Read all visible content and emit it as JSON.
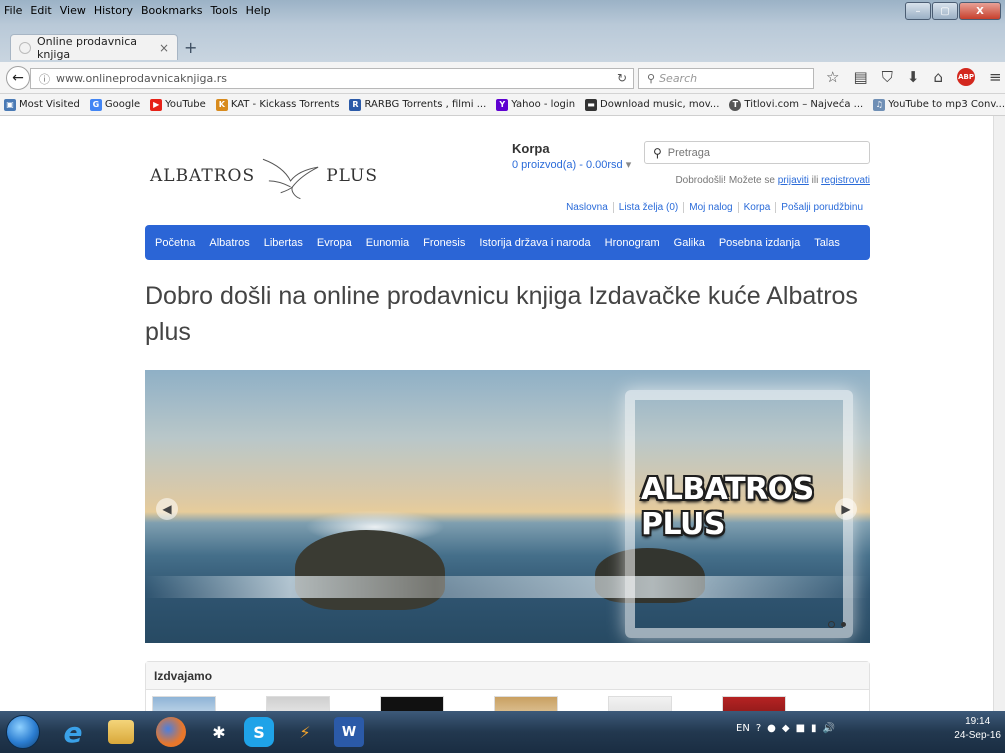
{
  "browser": {
    "menu": [
      "File",
      "Edit",
      "View",
      "History",
      "Bookmarks",
      "Tools",
      "Help"
    ],
    "tab_title": "Online prodavnica knjiga",
    "tab_close": "×",
    "new_tab": "+",
    "url": "www.onlineprodavnicaknjiga.rs",
    "search_placeholder": "Search",
    "window_buttons": [
      "–",
      "▢",
      "X"
    ],
    "bookmarks": [
      {
        "label": "Most Visited",
        "icon": "most-visited-icon",
        "color": "#4a7ab5"
      },
      {
        "label": "Google",
        "icon": "google-icon",
        "color": "#4285f4"
      },
      {
        "label": "YouTube",
        "icon": "youtube-icon",
        "color": "#e62117"
      },
      {
        "label": "KAT - Kickass Torrents",
        "icon": "kat-icon",
        "color": "#d88b1e"
      },
      {
        "label": "RARBG Torrents , filmi ...",
        "icon": "rarbg-icon",
        "color": "#2b5aa8"
      },
      {
        "label": "Yahoo - login",
        "icon": "yahoo-icon",
        "color": "#5f01d1"
      },
      {
        "label": "Download music, mov...",
        "icon": "download-icon",
        "color": "#333333"
      },
      {
        "label": "Titlovi.com – Najveća ...",
        "icon": "titlovi-icon",
        "color": "#555555"
      },
      {
        "label": "YouTube to mp3 Conv...",
        "icon": "converter-icon",
        "color": "#6f8fb5"
      }
    ]
  },
  "site": {
    "logo_left": "ALBATROS",
    "logo_right": "PLUS",
    "cart_title": "Korpa",
    "cart_count": "0 proizvod(a) - 0.00rsd",
    "search_placeholder": "Pretraga",
    "welcome_text": "Dobrodošli! Možete se",
    "login_link": "prijaviti",
    "or_text": "ili",
    "register_link": "registrovati",
    "top_links": [
      "Naslovna",
      "Lista želja (0)",
      "Moj nalog",
      "Korpa",
      "Pošalji porudžbinu"
    ],
    "nav": [
      "Početna",
      "Albatros",
      "Libertas",
      "Evropa",
      "Eunomia",
      "Fronesis",
      "Istorija država i naroda",
      "Hronogram",
      "Galika",
      "Posebna izdanja",
      "Talas"
    ],
    "headline": "Dobro došli na online prodavnicu knjiga Izdavačke kuće Albatros plus",
    "slider_brand": "ALBATROS PLUS",
    "featured_title": "Izdvajamo",
    "accent_color": "#2b65d6",
    "link_color": "#2a6bd9"
  },
  "taskbar": {
    "lang": "EN",
    "time": "19:14",
    "date": "24-Sep-16"
  }
}
